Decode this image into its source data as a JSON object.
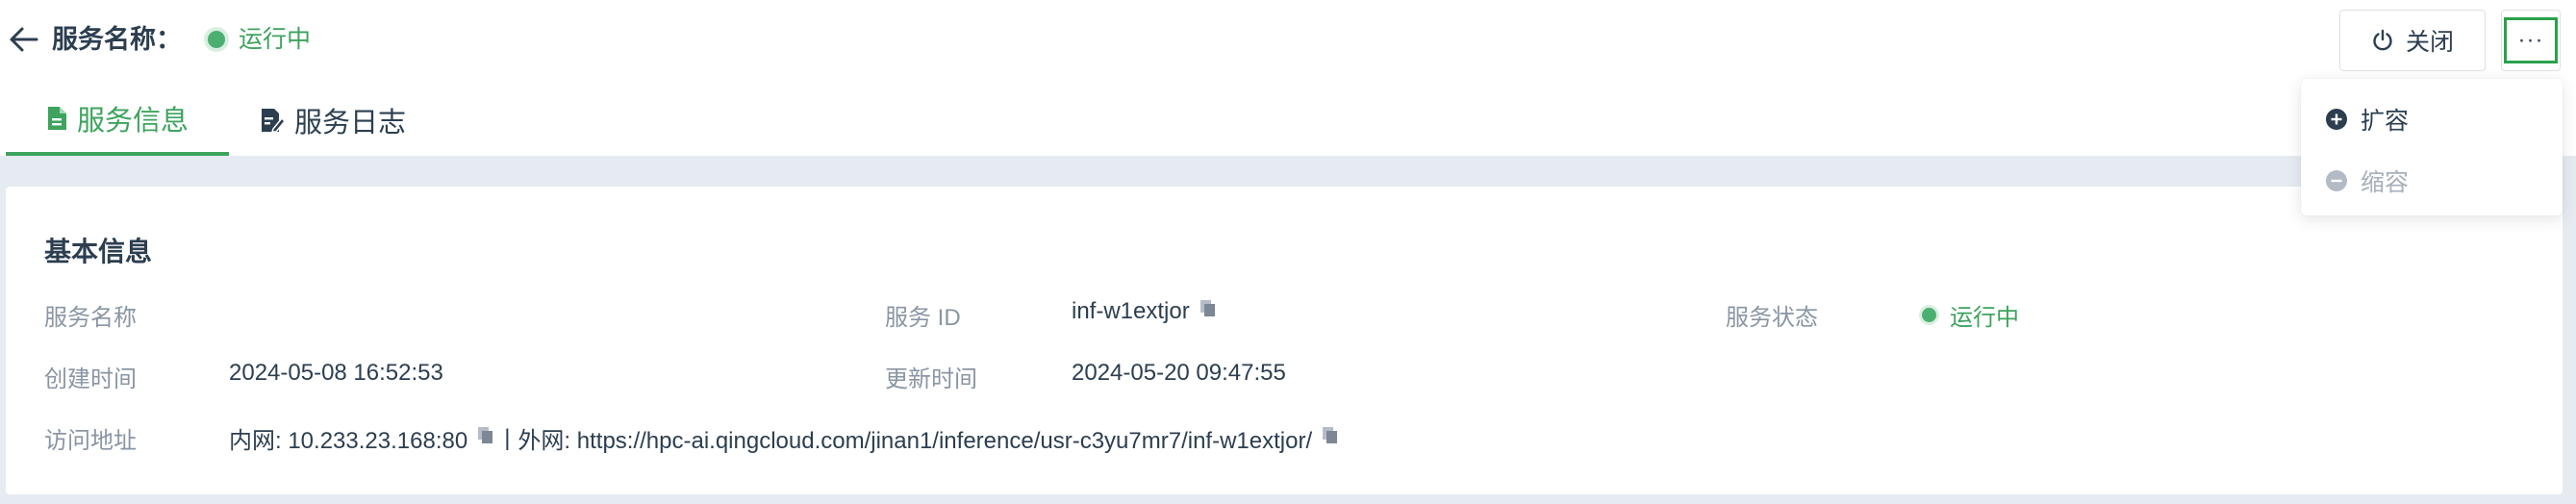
{
  "header": {
    "title": "服务名称：",
    "status": "运行中",
    "close_label": "关闭",
    "more_label": "···"
  },
  "tabs": [
    {
      "label": "服务信息",
      "active": true
    },
    {
      "label": "服务日志",
      "active": false
    }
  ],
  "dropdown": {
    "items": [
      {
        "label": "扩容",
        "enabled": true
      },
      {
        "label": "缩容",
        "enabled": false
      }
    ]
  },
  "info": {
    "title": "基本信息",
    "service_name_label": "服务名称",
    "service_name_value": "",
    "service_id_label": "服务 ID",
    "service_id_value": "inf-w1extjor",
    "service_status_label": "服务状态",
    "service_status_value": "运行中",
    "created_label": "创建时间",
    "created_value": "2024-05-08 16:52:53",
    "updated_label": "更新时间",
    "updated_value": "2024-05-20 09:47:55",
    "address_label": "访问地址",
    "internal_address": "内网: 10.233.23.168:80",
    "separator": "|",
    "external_address": "外网: https://hpc-ai.qingcloud.com/jinan1/inference/usr-c3yu7mr7/inf-w1extjor/"
  },
  "colors": {
    "accent_green": "#3da35d",
    "text_dark": "#2c3e50",
    "label_gray": "#8a95a4",
    "band_gray": "#e6ebf2"
  }
}
